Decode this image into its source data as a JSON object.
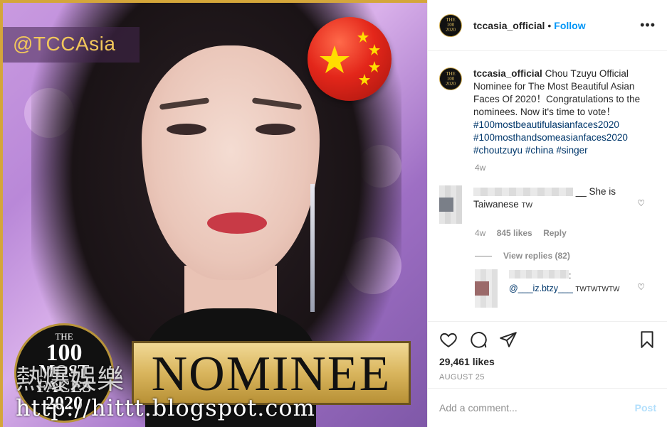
{
  "image": {
    "watermark": "@TCCAsia",
    "badge": {
      "line1": "THE",
      "line2": "100",
      "line3": "MOST",
      "line4": "FACES",
      "line5": "2020"
    },
    "nominee_label": "NOMINEE",
    "cn_watermark": "熱爆娛樂",
    "url_watermark": "http://hittt.blogspot.com",
    "flag_icon": "china-flag-icon"
  },
  "header": {
    "username": "tccasia_official",
    "dot": "•",
    "follow_label": "Follow",
    "more_icon": "more-options-icon"
  },
  "caption": {
    "username": "tccasia_official",
    "text": "Chou Tzuyu Official Nominee for The Most Beautiful Asian Faces Of 2020！Congratulations to the nominees. Now it's time to vote！",
    "hashtags": [
      "#100mostbeautifulasianfaces2020",
      "#100mosthandsomeasianfaces2020",
      "#choutzuyu",
      "#china",
      "#singer"
    ],
    "time": "4w"
  },
  "comment1": {
    "text_suffix": "__ She is",
    "text_line2": "Taiwanese",
    "flag_text": "TW",
    "time": "4w",
    "likes": "845 likes",
    "reply": "Reply",
    "view_replies": "View replies (82)"
  },
  "comment2": {
    "colon": ":",
    "mention": "@___iz.btzy___",
    "suffix": "TWTWTWTW"
  },
  "actions": {
    "likes": "29,461 likes",
    "date": "AUGUST 25"
  },
  "add_comment": {
    "placeholder": "Add a comment...",
    "post_label": "Post"
  },
  "colors": {
    "accent": "#0095f6",
    "hashtag": "#00376b",
    "muted": "#8e8e8e",
    "gold": "#d4a63a"
  }
}
